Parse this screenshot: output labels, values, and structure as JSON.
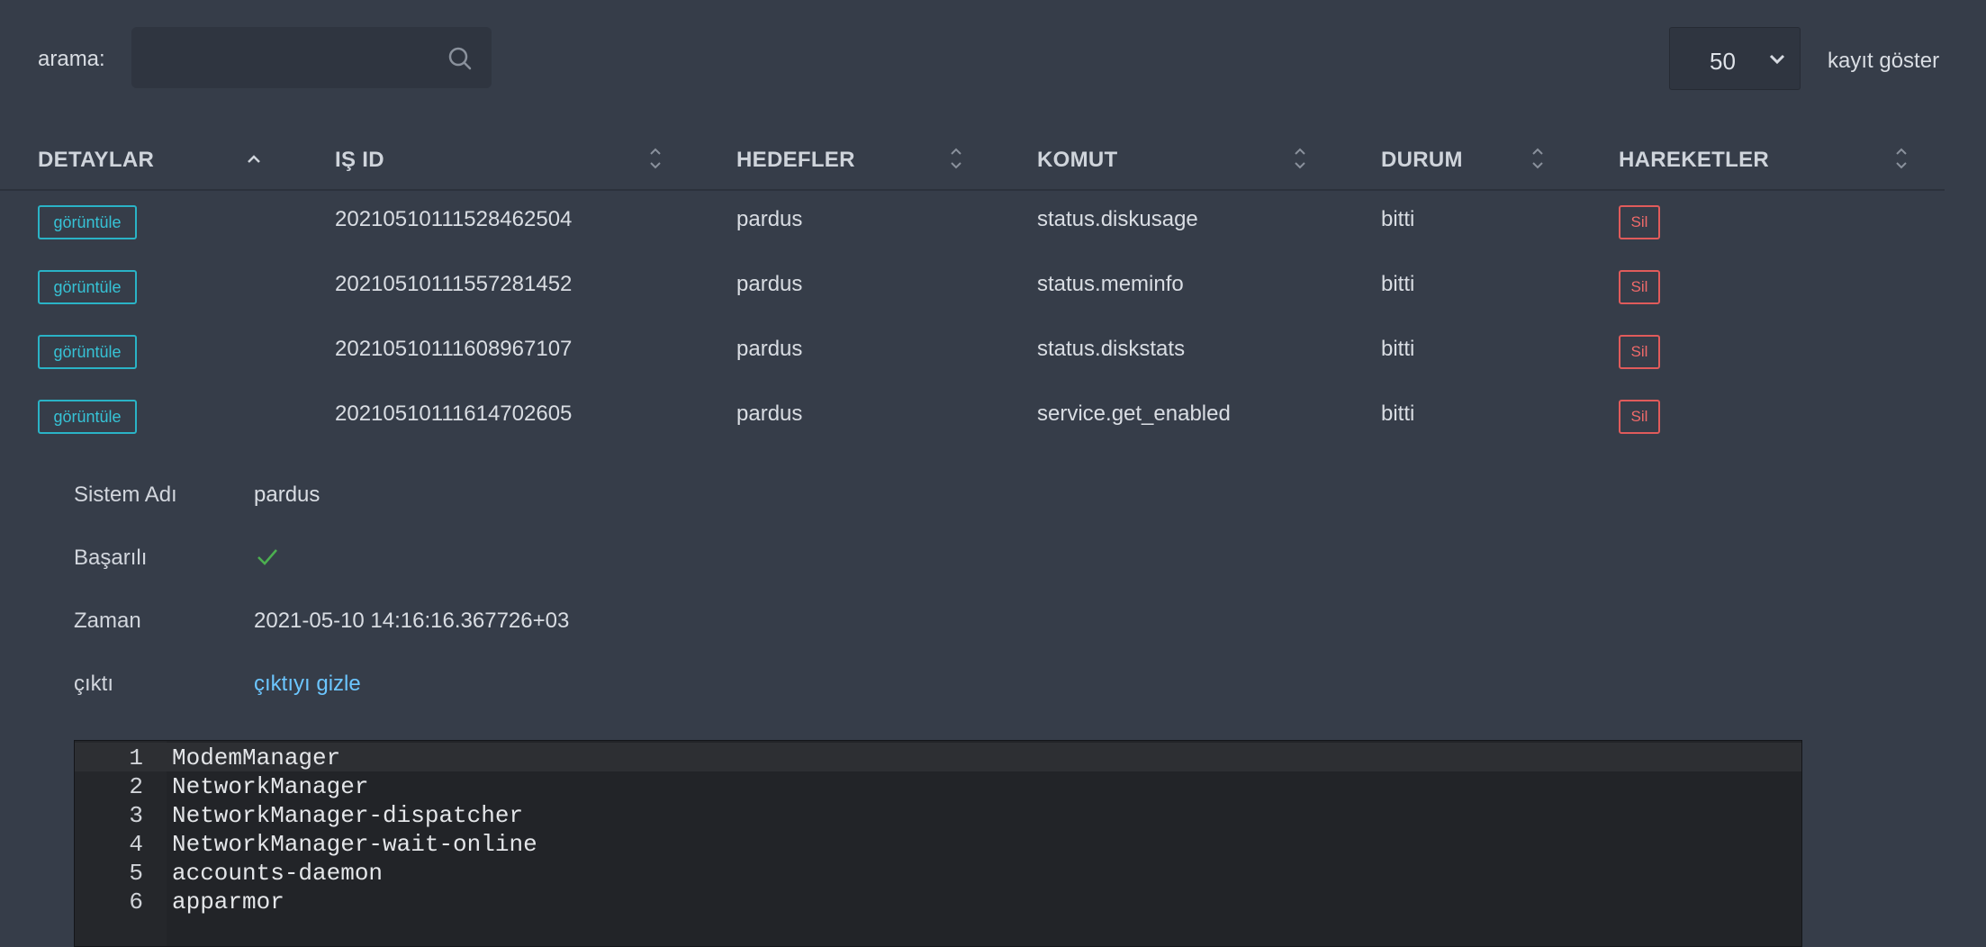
{
  "search": {
    "label": "arama:",
    "value": "",
    "placeholder": ""
  },
  "page_size": {
    "selected": "50",
    "suffix": "kayıt göster"
  },
  "table": {
    "columns": [
      "DETAYLAR",
      "IŞ ID",
      "HEDEFLER",
      "KOMUT",
      "DURUM",
      "HAREKETLER"
    ],
    "rows": [
      {
        "view_label": "görüntüle",
        "id": "20210510111528462504",
        "target": "pardus",
        "command": "status.diskusage",
        "status": "bitti",
        "delete_label": "Sil"
      },
      {
        "view_label": "görüntüle",
        "id": "20210510111557281452",
        "target": "pardus",
        "command": "status.meminfo",
        "status": "bitti",
        "delete_label": "Sil"
      },
      {
        "view_label": "görüntüle",
        "id": "20210510111608967107",
        "target": "pardus",
        "command": "status.diskstats",
        "status": "bitti",
        "delete_label": "Sil"
      },
      {
        "view_label": "görüntüle",
        "id": "20210510111614702605",
        "target": "pardus",
        "command": "service.get_enabled",
        "status": "bitti",
        "delete_label": "Sil"
      }
    ]
  },
  "details": {
    "system_name_label": "Sistem Adı",
    "system_name": "pardus",
    "success_label": "Başarılı",
    "success_icon": "check-icon",
    "time_label": "Zaman",
    "time": "2021-05-10 14:16:16.367726+03",
    "output_label": "çıktı",
    "output_toggle": "çıktıyı gizle"
  },
  "output": {
    "lines": [
      {
        "no": "1",
        "text": "ModemManager"
      },
      {
        "no": "2",
        "text": "NetworkManager"
      },
      {
        "no": "3",
        "text": "NetworkManager-dispatcher"
      },
      {
        "no": "4",
        "text": "NetworkManager-wait-online"
      },
      {
        "no": "5",
        "text": "accounts-daemon"
      },
      {
        "no": "6",
        "text": "apparmor"
      }
    ]
  },
  "colors": {
    "background": "#363d49",
    "view_button": "#2ab3c6",
    "delete_button": "#e05b5b",
    "link": "#6cc6ff",
    "success": "#4caf50"
  }
}
